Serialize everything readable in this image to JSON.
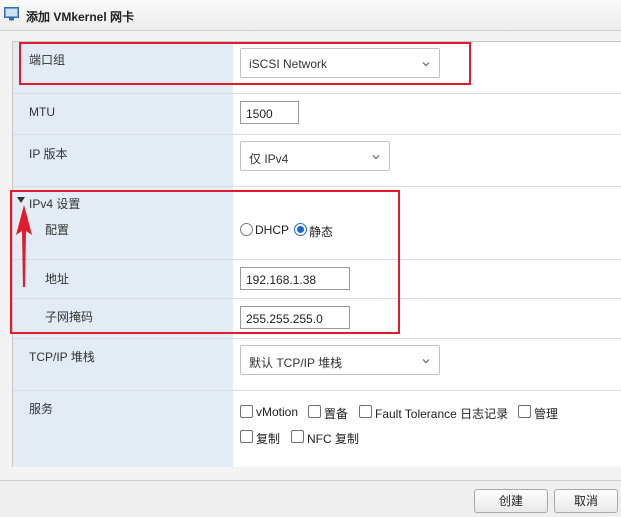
{
  "dialog": {
    "title": "添加 VMkernel 网卡"
  },
  "form": {
    "port_group": {
      "label": "端口组",
      "value": "iSCSI Network"
    },
    "mtu": {
      "label": "MTU",
      "value": "1500"
    },
    "ip_version": {
      "label": "IP 版本",
      "value": "仅 IPv4"
    },
    "ipv4_settings": {
      "section_label": "IPv4 设置",
      "config": {
        "label": "配置",
        "options": [
          "DHCP",
          "静态"
        ],
        "selected": "静态"
      },
      "address": {
        "label": "地址",
        "value": "192.168.1.38"
      },
      "subnet_mask": {
        "label": "子网掩码",
        "value": "255.255.255.0"
      }
    },
    "tcpip_stack": {
      "label": "TCP/IP 堆栈",
      "value": "默认 TCP/IP 堆栈"
    },
    "services": {
      "label": "服务",
      "items": [
        {
          "label": "vMotion",
          "checked": false
        },
        {
          "label": "置备",
          "checked": false
        },
        {
          "label": "Fault Tolerance 日志记录",
          "checked": false
        },
        {
          "label": "管理",
          "checked": false
        },
        {
          "label": "复制",
          "checked": false
        },
        {
          "label": "NFC 复制",
          "checked": false
        }
      ]
    }
  },
  "footer": {
    "create_label": "创建",
    "cancel_label": "取消"
  },
  "annotation_color": "#e01b2b",
  "accent_color": "#1f66c8"
}
